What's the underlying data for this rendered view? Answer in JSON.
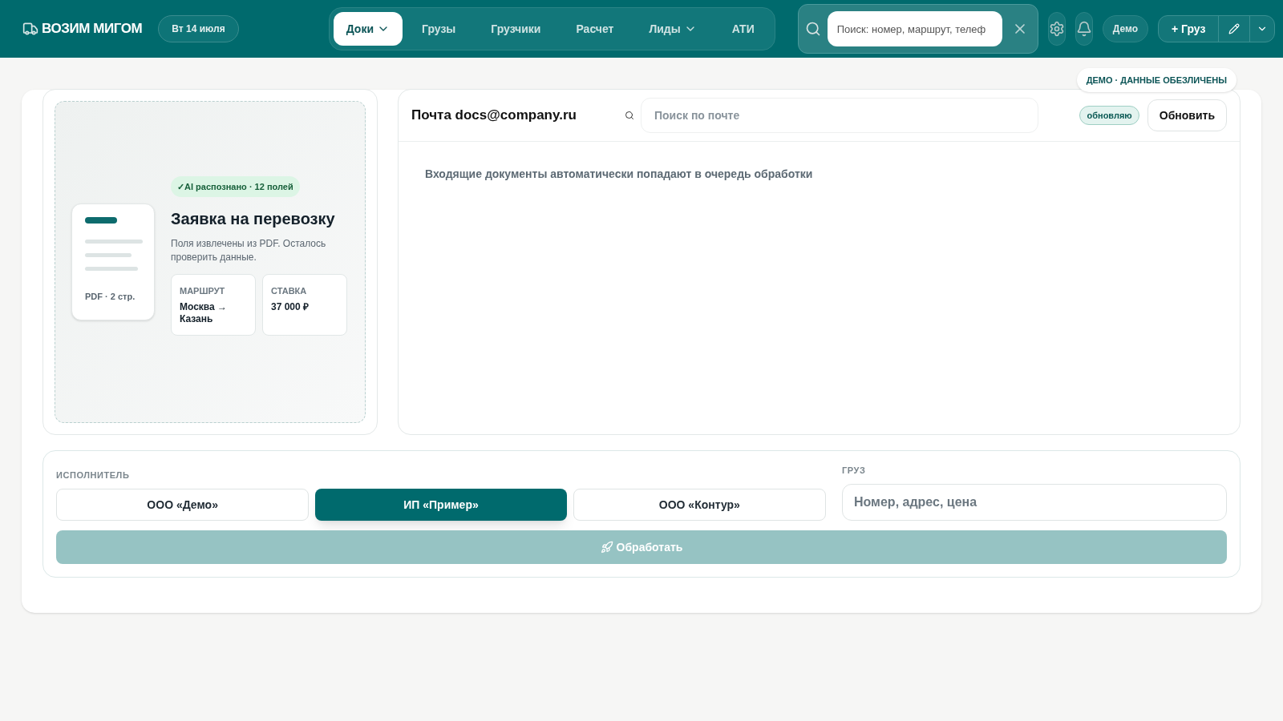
{
  "header": {
    "logo": "ВОЗИМ МИГОМ",
    "date": "Вт 14 июля",
    "nav": [
      {
        "label": "Доки",
        "selected": true,
        "dropdown": true
      },
      {
        "label": "Грузы",
        "selected": false,
        "dropdown": false
      },
      {
        "label": "Грузчики",
        "selected": false,
        "dropdown": false
      },
      {
        "label": "Расчет",
        "selected": false,
        "dropdown": false
      },
      {
        "label": "Лиды",
        "selected": false,
        "dropdown": true
      },
      {
        "label": "АТИ",
        "selected": false,
        "dropdown": false
      }
    ],
    "search": {
      "placeholder": "Поиск: номер, маршрут, телеф"
    },
    "user": "Демо",
    "add_button": "+ Груз"
  },
  "demo_badge": "ДЕМО · ДАННЫЕ ОБЕЗЛИЧЕНЫ",
  "preview": {
    "badge": "✓AI распознано · 12 полей",
    "doc_label": "PDF · 2 стр.",
    "title": "Заявка на перевозку",
    "description": "Поля извлечены из PDF. Осталось проверить данные.",
    "fields": [
      {
        "label": "МАРШРУТ",
        "value": "Москва → Казань"
      },
      {
        "label": "СТАВКА",
        "value": "37 000 ₽"
      }
    ]
  },
  "mail": {
    "title": "Почта docs@company.ru",
    "search": {
      "placeholder": "Поиск по почте"
    },
    "status": "обновляю",
    "refresh_button": "Обновить",
    "empty_text": "Входящие документы автоматически попадают в очередь обработки"
  },
  "form": {
    "executor_label": "ИСПОЛНИТЕЛЬ",
    "executors": [
      {
        "label": "ООО «Демо»",
        "selected": false
      },
      {
        "label": "ИП «Пример»",
        "selected": true
      },
      {
        "label": "ООО «Контур»",
        "selected": false
      }
    ],
    "cargo_label": "ГРУЗ",
    "cargo": {
      "placeholder": "Номер, адрес, цена"
    },
    "process_button": {
      "label": "Обработать",
      "disabled": true
    }
  }
}
